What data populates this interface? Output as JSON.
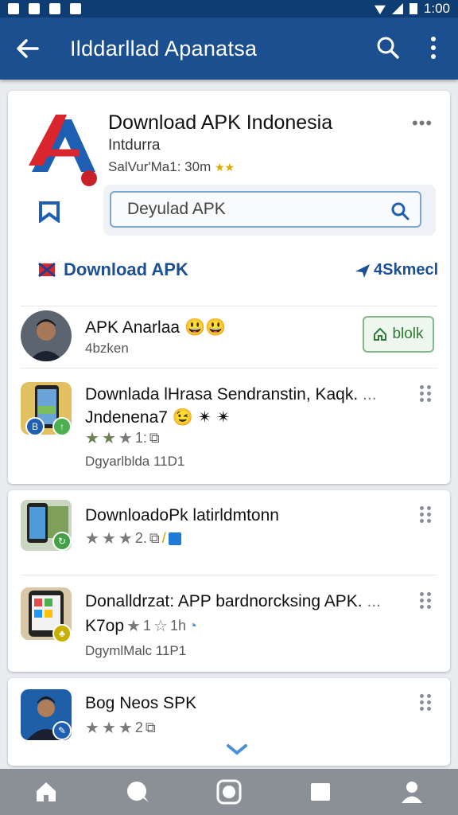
{
  "status_bar": {
    "time": "1:00"
  },
  "app_bar": {
    "title": "Ilddarllad Apanatsa"
  },
  "hero": {
    "title": "Download APK Indonesia",
    "subtitle": "Intdurra",
    "meta": "SalVur'Ma1: 30m",
    "stars": "★★",
    "more": "•••"
  },
  "search": {
    "value": "Deyulad APK"
  },
  "download_row": {
    "label": "Download APK",
    "right_label": "4Skmecl"
  },
  "list_card1": [
    {
      "title": "APK Anarlaa",
      "emoji": "😃😃",
      "sub": "4bzken",
      "button_label": "blolk"
    },
    {
      "title_line1": "Downlada lHrasa Sendranstin, Kaqk.",
      "dots": "...",
      "title_line2": "Jndenena7",
      "emoji": "😉 ✴ ✴",
      "rating_num": "1:",
      "footer": "Dgyarlblda 11D1"
    }
  ],
  "list_card2": [
    {
      "title": "DownloadoPk latirldmtonn",
      "rating_num": "2.",
      "extra": "/"
    },
    {
      "title": "Donalldrzat: APP bardnorcksing APK.",
      "dots": "...",
      "line2": "K7op",
      "rating_num": "1",
      "rating_extra": "1h",
      "footer": "DgymlMalc 11P1"
    }
  ],
  "list_card3": [
    {
      "title": "Bog Neos SPK",
      "rating_num": "2"
    }
  ],
  "colors": {
    "appbar": "#1b4f8f",
    "status_bar": "#0e3d73",
    "accent_blue": "#1d4f94",
    "install_green": "#2f7a36"
  }
}
